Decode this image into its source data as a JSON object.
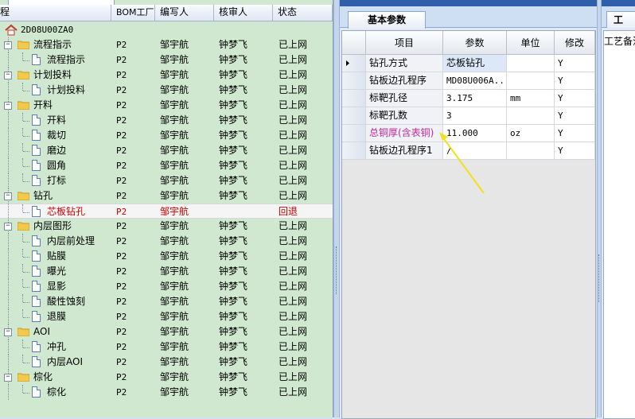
{
  "tree": {
    "columns": [
      "程",
      "BOM工厂",
      "编写人",
      "核审人",
      "状态"
    ],
    "root_label": "2D08U00ZA0",
    "rows": [
      {
        "level": 1,
        "kind": "folder",
        "name": "流程指示",
        "bom": "P2",
        "writer": "邹宇航",
        "reviewer": "钟梦飞",
        "status": "已上网"
      },
      {
        "level": 2,
        "kind": "doc",
        "name": "流程指示",
        "bom": "P2",
        "writer": "邹宇航",
        "reviewer": "钟梦飞",
        "status": "已上网"
      },
      {
        "level": 1,
        "kind": "folder",
        "name": "计划投料",
        "bom": "P2",
        "writer": "邹宇航",
        "reviewer": "钟梦飞",
        "status": "已上网"
      },
      {
        "level": 2,
        "kind": "doc",
        "name": "计划投料",
        "bom": "P2",
        "writer": "邹宇航",
        "reviewer": "钟梦飞",
        "status": "已上网"
      },
      {
        "level": 1,
        "kind": "folder",
        "name": "开料",
        "bom": "P2",
        "writer": "邹宇航",
        "reviewer": "钟梦飞",
        "status": "已上网"
      },
      {
        "level": 2,
        "kind": "doc",
        "name": "开料",
        "bom": "P2",
        "writer": "邹宇航",
        "reviewer": "钟梦飞",
        "status": "已上网"
      },
      {
        "level": 2,
        "kind": "doc",
        "name": "裁切",
        "bom": "P2",
        "writer": "邹宇航",
        "reviewer": "钟梦飞",
        "status": "已上网"
      },
      {
        "level": 2,
        "kind": "doc",
        "name": "磨边",
        "bom": "P2",
        "writer": "邹宇航",
        "reviewer": "钟梦飞",
        "status": "已上网"
      },
      {
        "level": 2,
        "kind": "doc",
        "name": "圆角",
        "bom": "P2",
        "writer": "邹宇航",
        "reviewer": "钟梦飞",
        "status": "已上网"
      },
      {
        "level": 2,
        "kind": "doc",
        "name": "打标",
        "bom": "P2",
        "writer": "邹宇航",
        "reviewer": "钟梦飞",
        "status": "已上网"
      },
      {
        "level": 1,
        "kind": "folder",
        "name": "钻孔",
        "bom": "P2",
        "writer": "邹宇航",
        "reviewer": "钟梦飞",
        "status": "已上网"
      },
      {
        "level": 2,
        "kind": "doc",
        "name": "芯板钻孔",
        "bom": "P2",
        "writer": "邹宇航",
        "reviewer": "",
        "status": "回退",
        "selected": true
      },
      {
        "level": 1,
        "kind": "folder",
        "name": "内层图形",
        "bom": "P2",
        "writer": "邹宇航",
        "reviewer": "钟梦飞",
        "status": "已上网"
      },
      {
        "level": 2,
        "kind": "doc",
        "name": "内层前处理",
        "bom": "P2",
        "writer": "邹宇航",
        "reviewer": "钟梦飞",
        "status": "已上网"
      },
      {
        "level": 2,
        "kind": "doc",
        "name": "贴膜",
        "bom": "P2",
        "writer": "邹宇航",
        "reviewer": "钟梦飞",
        "status": "已上网"
      },
      {
        "level": 2,
        "kind": "doc",
        "name": "曝光",
        "bom": "P2",
        "writer": "邹宇航",
        "reviewer": "钟梦飞",
        "status": "已上网"
      },
      {
        "level": 2,
        "kind": "doc",
        "name": "显影",
        "bom": "P2",
        "writer": "邹宇航",
        "reviewer": "钟梦飞",
        "status": "已上网"
      },
      {
        "level": 2,
        "kind": "doc",
        "name": "酸性蚀刻",
        "bom": "P2",
        "writer": "邹宇航",
        "reviewer": "钟梦飞",
        "status": "已上网"
      },
      {
        "level": 2,
        "kind": "doc",
        "name": "退膜",
        "bom": "P2",
        "writer": "邹宇航",
        "reviewer": "钟梦飞",
        "status": "已上网"
      },
      {
        "level": 1,
        "kind": "folder",
        "name": "AOI",
        "bom": "P2",
        "writer": "邹宇航",
        "reviewer": "钟梦飞",
        "status": "已上网"
      },
      {
        "level": 2,
        "kind": "doc",
        "name": "冲孔",
        "bom": "P2",
        "writer": "邹宇航",
        "reviewer": "钟梦飞",
        "status": "已上网"
      },
      {
        "level": 2,
        "kind": "doc",
        "name": "内层AOI",
        "bom": "P2",
        "writer": "邹宇航",
        "reviewer": "钟梦飞",
        "status": "已上网"
      },
      {
        "level": 1,
        "kind": "folder",
        "name": "棕化",
        "bom": "P2",
        "writer": "邹宇航",
        "reviewer": "钟梦飞",
        "status": "已上网"
      },
      {
        "level": 2,
        "kind": "doc",
        "name": "棕化",
        "bom": "P2",
        "writer": "邹宇航",
        "reviewer": "钟梦飞",
        "status": "已上网"
      }
    ]
  },
  "middle": {
    "tab_label": "基本参数",
    "columns": [
      "项目",
      "参数",
      "单位",
      "修改"
    ],
    "params": [
      {
        "item": "钻孔方式",
        "value": "芯板钻孔",
        "unit": "",
        "modify": "Y",
        "current": true
      },
      {
        "item": "钻板边孔程序",
        "value": "MD08U006A...",
        "unit": "",
        "modify": "Y"
      },
      {
        "item": "标靶孔径",
        "value": "3.175",
        "unit": "mm",
        "modify": "Y"
      },
      {
        "item": "标靶孔数",
        "value": "3",
        "unit": "",
        "modify": "Y"
      },
      {
        "item": "总铜厚(含表铜)",
        "value": "11.000",
        "unit": "oz",
        "modify": "Y",
        "warn": true
      },
      {
        "item": "钻板边孔程序1",
        "value": "/",
        "unit": "",
        "modify": "Y"
      }
    ]
  },
  "right": {
    "tab_label": "工",
    "panel_label": "工艺备注"
  },
  "colors": {
    "tree_bg": "#cfe8cf",
    "selected_text": "#cc0000",
    "warn_text": "#c0299c",
    "arrow": "#f0e020"
  }
}
